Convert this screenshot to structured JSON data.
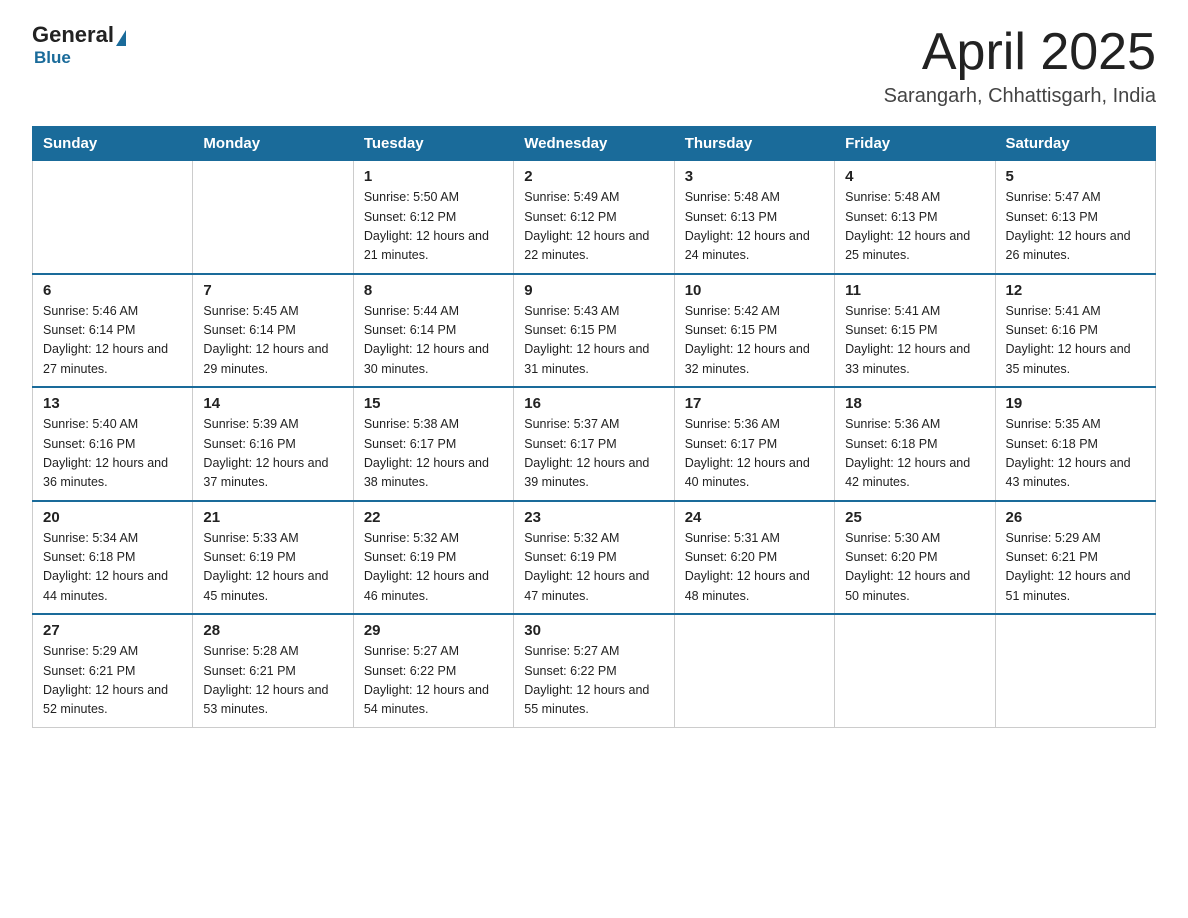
{
  "header": {
    "logo": {
      "general": "General",
      "blue": "Blue"
    },
    "month_title": "April 2025",
    "location": "Sarangarh, Chhattisgarh, India"
  },
  "weekdays": [
    "Sunday",
    "Monday",
    "Tuesday",
    "Wednesday",
    "Thursday",
    "Friday",
    "Saturday"
  ],
  "weeks": [
    [
      {
        "day": "",
        "sunrise": "",
        "sunset": "",
        "daylight": ""
      },
      {
        "day": "",
        "sunrise": "",
        "sunset": "",
        "daylight": ""
      },
      {
        "day": "1",
        "sunrise": "Sunrise: 5:50 AM",
        "sunset": "Sunset: 6:12 PM",
        "daylight": "Daylight: 12 hours and 21 minutes."
      },
      {
        "day": "2",
        "sunrise": "Sunrise: 5:49 AM",
        "sunset": "Sunset: 6:12 PM",
        "daylight": "Daylight: 12 hours and 22 minutes."
      },
      {
        "day": "3",
        "sunrise": "Sunrise: 5:48 AM",
        "sunset": "Sunset: 6:13 PM",
        "daylight": "Daylight: 12 hours and 24 minutes."
      },
      {
        "day": "4",
        "sunrise": "Sunrise: 5:48 AM",
        "sunset": "Sunset: 6:13 PM",
        "daylight": "Daylight: 12 hours and 25 minutes."
      },
      {
        "day": "5",
        "sunrise": "Sunrise: 5:47 AM",
        "sunset": "Sunset: 6:13 PM",
        "daylight": "Daylight: 12 hours and 26 minutes."
      }
    ],
    [
      {
        "day": "6",
        "sunrise": "Sunrise: 5:46 AM",
        "sunset": "Sunset: 6:14 PM",
        "daylight": "Daylight: 12 hours and 27 minutes."
      },
      {
        "day": "7",
        "sunrise": "Sunrise: 5:45 AM",
        "sunset": "Sunset: 6:14 PM",
        "daylight": "Daylight: 12 hours and 29 minutes."
      },
      {
        "day": "8",
        "sunrise": "Sunrise: 5:44 AM",
        "sunset": "Sunset: 6:14 PM",
        "daylight": "Daylight: 12 hours and 30 minutes."
      },
      {
        "day": "9",
        "sunrise": "Sunrise: 5:43 AM",
        "sunset": "Sunset: 6:15 PM",
        "daylight": "Daylight: 12 hours and 31 minutes."
      },
      {
        "day": "10",
        "sunrise": "Sunrise: 5:42 AM",
        "sunset": "Sunset: 6:15 PM",
        "daylight": "Daylight: 12 hours and 32 minutes."
      },
      {
        "day": "11",
        "sunrise": "Sunrise: 5:41 AM",
        "sunset": "Sunset: 6:15 PM",
        "daylight": "Daylight: 12 hours and 33 minutes."
      },
      {
        "day": "12",
        "sunrise": "Sunrise: 5:41 AM",
        "sunset": "Sunset: 6:16 PM",
        "daylight": "Daylight: 12 hours and 35 minutes."
      }
    ],
    [
      {
        "day": "13",
        "sunrise": "Sunrise: 5:40 AM",
        "sunset": "Sunset: 6:16 PM",
        "daylight": "Daylight: 12 hours and 36 minutes."
      },
      {
        "day": "14",
        "sunrise": "Sunrise: 5:39 AM",
        "sunset": "Sunset: 6:16 PM",
        "daylight": "Daylight: 12 hours and 37 minutes."
      },
      {
        "day": "15",
        "sunrise": "Sunrise: 5:38 AM",
        "sunset": "Sunset: 6:17 PM",
        "daylight": "Daylight: 12 hours and 38 minutes."
      },
      {
        "day": "16",
        "sunrise": "Sunrise: 5:37 AM",
        "sunset": "Sunset: 6:17 PM",
        "daylight": "Daylight: 12 hours and 39 minutes."
      },
      {
        "day": "17",
        "sunrise": "Sunrise: 5:36 AM",
        "sunset": "Sunset: 6:17 PM",
        "daylight": "Daylight: 12 hours and 40 minutes."
      },
      {
        "day": "18",
        "sunrise": "Sunrise: 5:36 AM",
        "sunset": "Sunset: 6:18 PM",
        "daylight": "Daylight: 12 hours and 42 minutes."
      },
      {
        "day": "19",
        "sunrise": "Sunrise: 5:35 AM",
        "sunset": "Sunset: 6:18 PM",
        "daylight": "Daylight: 12 hours and 43 minutes."
      }
    ],
    [
      {
        "day": "20",
        "sunrise": "Sunrise: 5:34 AM",
        "sunset": "Sunset: 6:18 PM",
        "daylight": "Daylight: 12 hours and 44 minutes."
      },
      {
        "day": "21",
        "sunrise": "Sunrise: 5:33 AM",
        "sunset": "Sunset: 6:19 PM",
        "daylight": "Daylight: 12 hours and 45 minutes."
      },
      {
        "day": "22",
        "sunrise": "Sunrise: 5:32 AM",
        "sunset": "Sunset: 6:19 PM",
        "daylight": "Daylight: 12 hours and 46 minutes."
      },
      {
        "day": "23",
        "sunrise": "Sunrise: 5:32 AM",
        "sunset": "Sunset: 6:19 PM",
        "daylight": "Daylight: 12 hours and 47 minutes."
      },
      {
        "day": "24",
        "sunrise": "Sunrise: 5:31 AM",
        "sunset": "Sunset: 6:20 PM",
        "daylight": "Daylight: 12 hours and 48 minutes."
      },
      {
        "day": "25",
        "sunrise": "Sunrise: 5:30 AM",
        "sunset": "Sunset: 6:20 PM",
        "daylight": "Daylight: 12 hours and 50 minutes."
      },
      {
        "day": "26",
        "sunrise": "Sunrise: 5:29 AM",
        "sunset": "Sunset: 6:21 PM",
        "daylight": "Daylight: 12 hours and 51 minutes."
      }
    ],
    [
      {
        "day": "27",
        "sunrise": "Sunrise: 5:29 AM",
        "sunset": "Sunset: 6:21 PM",
        "daylight": "Daylight: 12 hours and 52 minutes."
      },
      {
        "day": "28",
        "sunrise": "Sunrise: 5:28 AM",
        "sunset": "Sunset: 6:21 PM",
        "daylight": "Daylight: 12 hours and 53 minutes."
      },
      {
        "day": "29",
        "sunrise": "Sunrise: 5:27 AM",
        "sunset": "Sunset: 6:22 PM",
        "daylight": "Daylight: 12 hours and 54 minutes."
      },
      {
        "day": "30",
        "sunrise": "Sunrise: 5:27 AM",
        "sunset": "Sunset: 6:22 PM",
        "daylight": "Daylight: 12 hours and 55 minutes."
      },
      {
        "day": "",
        "sunrise": "",
        "sunset": "",
        "daylight": ""
      },
      {
        "day": "",
        "sunrise": "",
        "sunset": "",
        "daylight": ""
      },
      {
        "day": "",
        "sunrise": "",
        "sunset": "",
        "daylight": ""
      }
    ]
  ]
}
